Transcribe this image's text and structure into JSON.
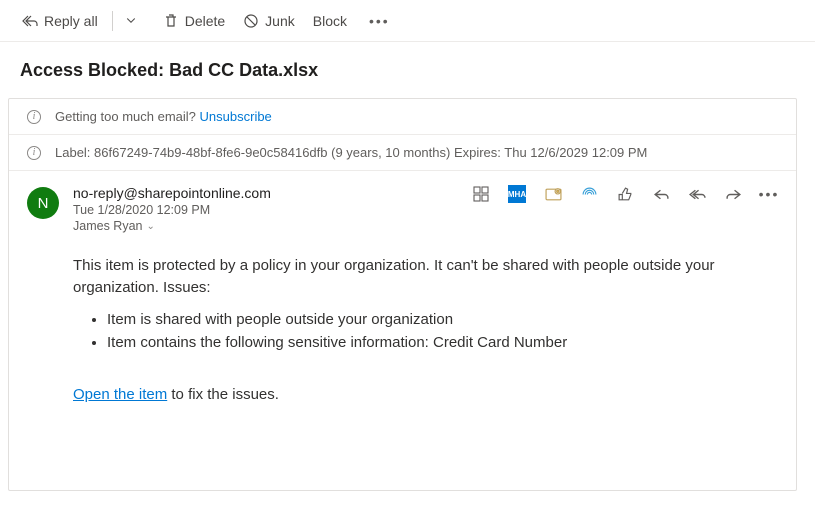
{
  "toolbar": {
    "reply_all": "Reply all",
    "delete": "Delete",
    "junk": "Junk",
    "block": "Block"
  },
  "subject": "Access Blocked: Bad CC Data.xlsx",
  "notices": {
    "unsub_prefix": "Getting too much email? ",
    "unsub_link": "Unsubscribe",
    "label_line": "Label: 86f67249-74b9-48bf-8fe6-9e0c58416dfb (9 years, 10 months) Expires: Thu 12/6/2029 12:09 PM"
  },
  "message": {
    "avatar_initial": "N",
    "from": "no-reply@sharepointonline.com",
    "date": "Tue 1/28/2020 12:09 PM",
    "to_name": "James Ryan",
    "mha_label": "MHA",
    "body_p1": "This item is protected by a policy in your organization. It can't be shared with people outside your organization. Issues:",
    "issue1": "Item is shared with people outside your organization",
    "issue2": "Item contains the following sensitive information: Credit Card Number",
    "open_link": "Open the item",
    "open_suffix": " to fix the issues."
  }
}
